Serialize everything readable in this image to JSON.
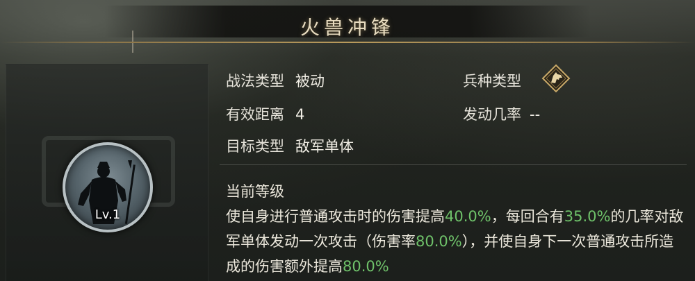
{
  "title": "火兽冲锋",
  "skill_info": {
    "tactic_type": {
      "label": "战法类型",
      "value": "被动"
    },
    "range": {
      "label": "有效距离",
      "value": "4"
    },
    "target_type": {
      "label": "目标类型",
      "value": "敌军单体"
    },
    "troop_type": {
      "label": "兵种类型",
      "icon": "horse-head-icon"
    },
    "trigger_rate": {
      "label": "发动几率",
      "value": "--"
    }
  },
  "portrait": {
    "level": "Lv.1",
    "icon": "warrior-silhouette-icon"
  },
  "current_level": {
    "title": "当前等级",
    "desc": {
      "p1": "使自身进行普通攻击时的伤害提高",
      "v1": "40.0%",
      "p2": "，每回合有",
      "v2": "35.0%",
      "p3": "的几率对敌军单体发动一次攻击（伤害率",
      "v3": "80.0%",
      "p4": "），并使自身下一次普通攻击所造成的伤害额外提高",
      "v4": "80.0%"
    }
  },
  "colors": {
    "highlight": "#6fc26a",
    "gold": "#b99a5c"
  }
}
